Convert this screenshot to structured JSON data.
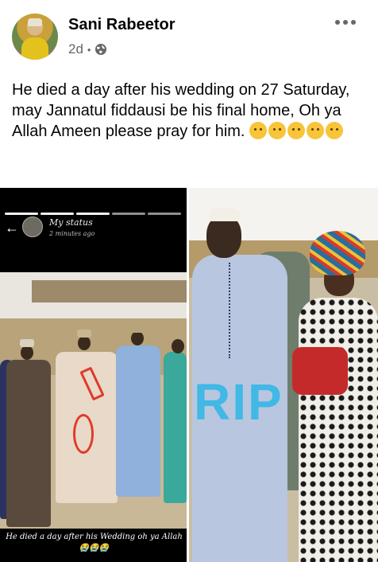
{
  "post": {
    "author_name": "Sani Rabeetor",
    "timestamp": "2d",
    "separator": "•",
    "privacy_icon": "globe-icon",
    "more_icon": "more-options-icon",
    "text": "He died a day after his wedding on 27 Saturday, may Jannatul fiddausi be his final home, Oh ya Allah Ameen please pray for him.",
    "emojis": [
      "sad-face-emoji",
      "crying-face-emoji",
      "loudly-crying-face-emoji",
      "loudly-crying-face-emoji",
      "loudly-crying-face-emoji"
    ]
  },
  "images": {
    "left": {
      "status_title": "My status",
      "status_time": "2 minutes ago",
      "back_icon": "back-arrow-icon",
      "caption": "He died a day after his Wedding oh ya Allah 😭😭😭"
    },
    "right": {
      "overlay_text": "RIP"
    }
  },
  "colors": {
    "name_text": "#050505",
    "meta_text": "#65676b",
    "rip_overlay": "#35b7e6",
    "red_annotation": "#e03a2a"
  }
}
